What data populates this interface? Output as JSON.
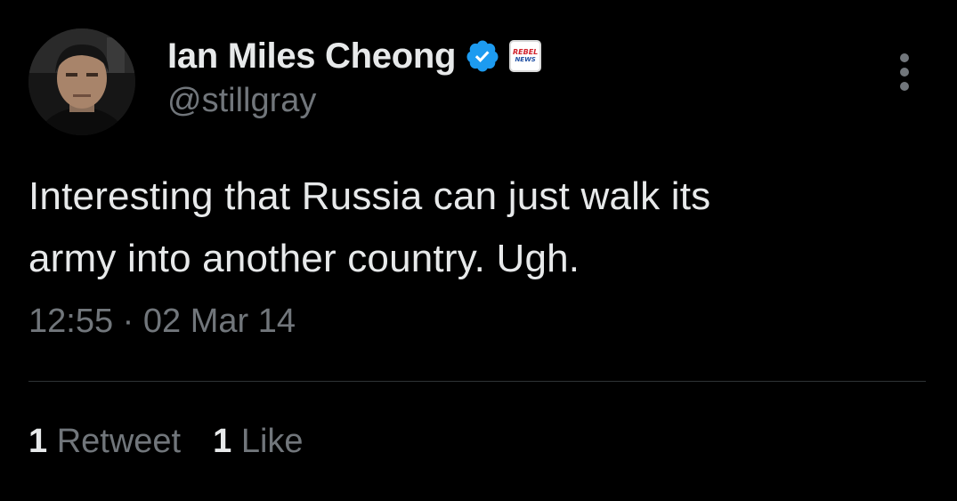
{
  "user": {
    "display_name": "Ian Miles Cheong",
    "handle": "@stillgray",
    "verified_icon": "verified-badge-icon",
    "affiliate_badge": {
      "line1": "REBEL",
      "line2": "NEWS"
    }
  },
  "tweet": {
    "line1": "Interesting that Russia can just walk its",
    "line2": "army into another country. Ugh.",
    "time": "12:55",
    "separator": "·",
    "date": "02 Mar 14"
  },
  "stats": {
    "retweets_count": "1",
    "retweets_label": "Retweet",
    "likes_count": "1",
    "likes_label": "Like"
  },
  "colors": {
    "background": "#000000",
    "primary_text": "#e7e9ea",
    "secondary_text": "#71767b",
    "verified_blue": "#1d9bf0",
    "divider": "#2f3336"
  }
}
